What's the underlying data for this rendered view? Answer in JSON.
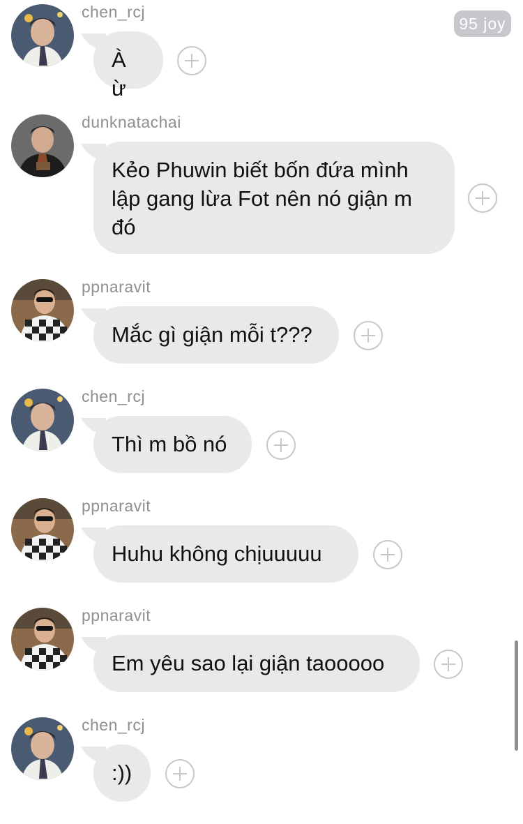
{
  "badge": {
    "label": "95 joy"
  },
  "messages": [
    {
      "user": "chen_rcj",
      "avatar": "avatar-chen",
      "text": "À ừ"
    },
    {
      "user": "dunknatachai",
      "avatar": "avatar-dunk",
      "text": "Kẻo Phuwin biết bốn đứa mình\nlập gang lừa Fot nên nó giận m\nđó"
    },
    {
      "user": "ppnaravit",
      "avatar": "avatar-pp",
      "text": "Mắc gì giận mỗi t???"
    },
    {
      "user": "chen_rcj",
      "avatar": "avatar-chen",
      "text": "Thì m bồ nó"
    },
    {
      "user": "ppnaravit",
      "avatar": "avatar-pp",
      "text": "Huhu không chịuuuuu"
    },
    {
      "user": "ppnaravit",
      "avatar": "avatar-pp",
      "text": "Em yêu sao lại giận taooooo"
    },
    {
      "user": "chen_rcj",
      "avatar": "avatar-chen",
      "text": ":))"
    }
  ],
  "colors": {
    "bubble": "#e9e9eb",
    "username": "#8e8e93",
    "plus": "#c7c7cc",
    "badge": "#c7c7cc"
  }
}
